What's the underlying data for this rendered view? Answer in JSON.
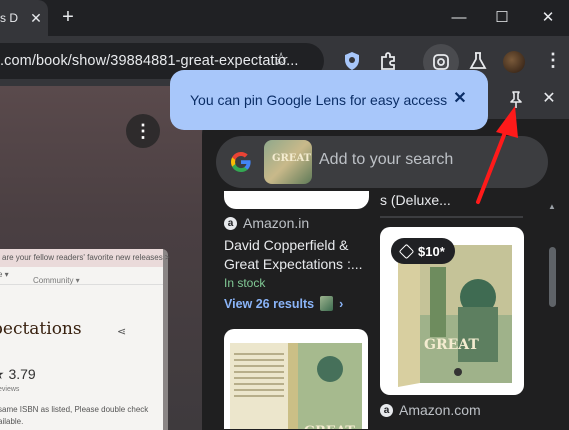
{
  "tab": {
    "title": "s D",
    "close": "✕"
  },
  "newtab": "+",
  "window": {
    "minimize": "—",
    "maximize": "☐",
    "close": "✕"
  },
  "toolbar": {
    "url": ".com/book/show/39884881-great-expectatio..."
  },
  "page": {
    "banner": "are your fellow readers' favorite new releases  >",
    "nav_left": "se ▾",
    "nav_right": "Community ▾",
    "book_title": "pectations",
    "rating_text": "★ 3.79",
    "reviews": "eviews",
    "note_line1": "same ISBN as listed, Please double check",
    "note_line2": "ailable.",
    "menu": "⋮"
  },
  "lens": {
    "search_placeholder": "Add to your search",
    "thumb_label": "GREAT",
    "top_right_fragment": "s (Deluxe...",
    "result1": {
      "source": "Amazon.in",
      "title": "David Copperfield & Great Expectations :...",
      "stock": "In stock",
      "view": "View 26 results",
      "chevron": "›"
    },
    "result2": {
      "price": "$10*",
      "source": "Amazon.com"
    }
  },
  "toast": {
    "message": "You can pin Google Lens for easy access",
    "close": "✕"
  },
  "panel": {
    "close": "✕"
  },
  "colors": {
    "accent": "#a8c7fa",
    "arrow": "#ff1a1a",
    "link": "#8ab4f8",
    "stock": "#81c995"
  }
}
